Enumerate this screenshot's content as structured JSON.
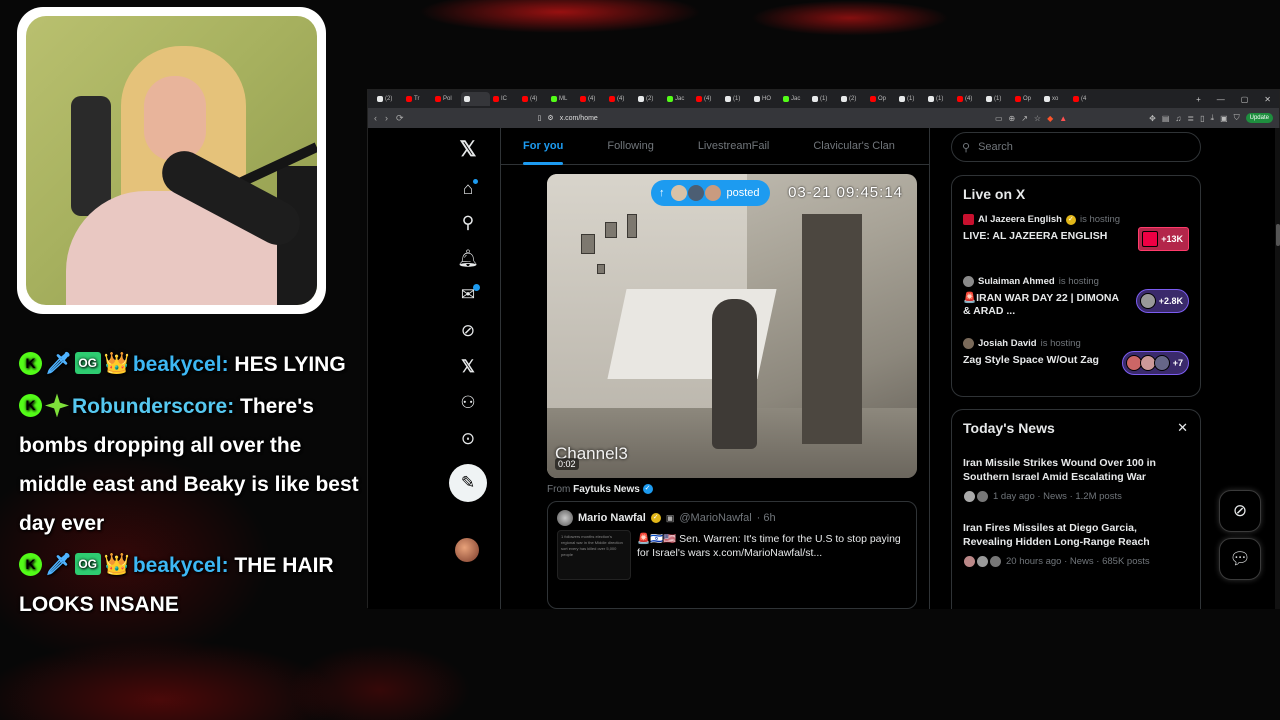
{
  "chat": {
    "messages": [
      {
        "username": "beakycel:",
        "text": "HES LYING",
        "badges": [
          "kick-badge",
          "sword-badge",
          "og-badge",
          "crown-badge"
        ]
      },
      {
        "username": "Robunderscore:",
        "text": "There's bombs dropping all over the middle east and Beaky is like best day ever",
        "badges": [
          "kick-badge",
          "diamond-badge"
        ]
      },
      {
        "username": "beakycel:",
        "text": "THE HAIR LOOKS INSANE",
        "badges": [
          "kick-badge",
          "sword-badge",
          "og-badge",
          "crown-badge"
        ]
      }
    ],
    "og_badge_text": "OG"
  },
  "browser": {
    "tabs": [
      {
        "label": "(2)",
        "favicon_color": "#e7e9ea"
      },
      {
        "label": "Tr",
        "favicon_color": "#ff0000"
      },
      {
        "label": "Pol",
        "favicon_color": "#ff0000"
      },
      {
        "label": "",
        "favicon_color": "#e7e9ea",
        "active": true
      },
      {
        "label": "IC",
        "favicon_color": "#ff0000"
      },
      {
        "label": "(4)",
        "favicon_color": "#ff0000"
      },
      {
        "label": "ML",
        "favicon_color": "#53fc18"
      },
      {
        "label": "(4)",
        "favicon_color": "#ff0000"
      },
      {
        "label": "(4)",
        "favicon_color": "#ff0000"
      },
      {
        "label": "(2)",
        "favicon_color": "#e7e9ea"
      },
      {
        "label": "Jac",
        "favicon_color": "#53fc18"
      },
      {
        "label": "(4)",
        "favicon_color": "#ff0000"
      },
      {
        "label": "(1)",
        "favicon_color": "#e7e9ea"
      },
      {
        "label": "HO",
        "favicon_color": "#e7e9ea"
      },
      {
        "label": "Jac",
        "favicon_color": "#53fc18"
      },
      {
        "label": "(1)",
        "favicon_color": "#e7e9ea"
      },
      {
        "label": "(2)",
        "favicon_color": "#e7e9ea"
      },
      {
        "label": "Op",
        "favicon_color": "#ff0000"
      },
      {
        "label": "(1)",
        "favicon_color": "#e7e9ea"
      },
      {
        "label": "(1)",
        "favicon_color": "#e7e9ea"
      },
      {
        "label": "(4)",
        "favicon_color": "#ff0000"
      },
      {
        "label": "(1)",
        "favicon_color": "#e7e9ea"
      },
      {
        "label": "Op",
        "favicon_color": "#ff0000"
      },
      {
        "label": "xo",
        "favicon_color": "#e7e9ea"
      },
      {
        "label": "(4",
        "favicon_color": "#ff0000"
      }
    ],
    "url": "x.com/home",
    "update_label": "Update"
  },
  "x": {
    "timeline_tabs": [
      "For you",
      "Following",
      "LivestreamFail",
      "Clavicular's Clan"
    ],
    "video": {
      "posted_label": "posted",
      "timestamp": "03-21  09:45:14",
      "overlay_label": "Channel3",
      "duration": "0:02"
    },
    "from": {
      "prefix": "From",
      "source": "Faytuks News"
    },
    "quote": {
      "name": "Mario Nawfal",
      "handle": "@MarioNawfal",
      "time": "· 6h",
      "text": "🚨🇮🇱🇺🇸 Sen. Warren: It's time for the U.S to stop paying for Israel's wars  x.com/MarioNawfal/st...",
      "thumb_text": "1 followers\nmonths election's regional war in the Middle direction\nsort every has killed over 5,000 people"
    },
    "search_placeholder": "Search",
    "live": {
      "title": "Live on X",
      "items": [
        {
          "host": "Al Jazeera English",
          "hosting": "is hosting",
          "title": "LIVE: AL JAZEERA ENGLISH",
          "count": "+13K",
          "pill_color": "#b3264a"
        },
        {
          "host": "Sulaiman Ahmed",
          "hosting": "is hosting",
          "title": "🚨IRAN WAR DAY 22 | DIMONA & ARAD ...",
          "count": "+2.8K",
          "pill_color": "#5b3fa8"
        },
        {
          "host": "Josiah David",
          "hosting": "is hosting",
          "title": "Zag Style Space W/Out Zag",
          "count": "+7",
          "pill_color": "#5b3fa8"
        }
      ]
    },
    "news": {
      "title": "Today's News",
      "items": [
        {
          "headline": "Iran Missile Strikes Wound Over 100 in Southern Israel Amid Escalating War",
          "meta": "1 day ago · News · 1.2M posts"
        },
        {
          "headline": "Iran Fires Missiles at Diego Garcia, Revealing Hidden Long-Range Reach",
          "meta": "20 hours ago · News · 685K posts"
        }
      ]
    }
  },
  "colors": {
    "accent": "#1d9bf0",
    "kick_green": "#53fc18",
    "background": "#000000"
  }
}
